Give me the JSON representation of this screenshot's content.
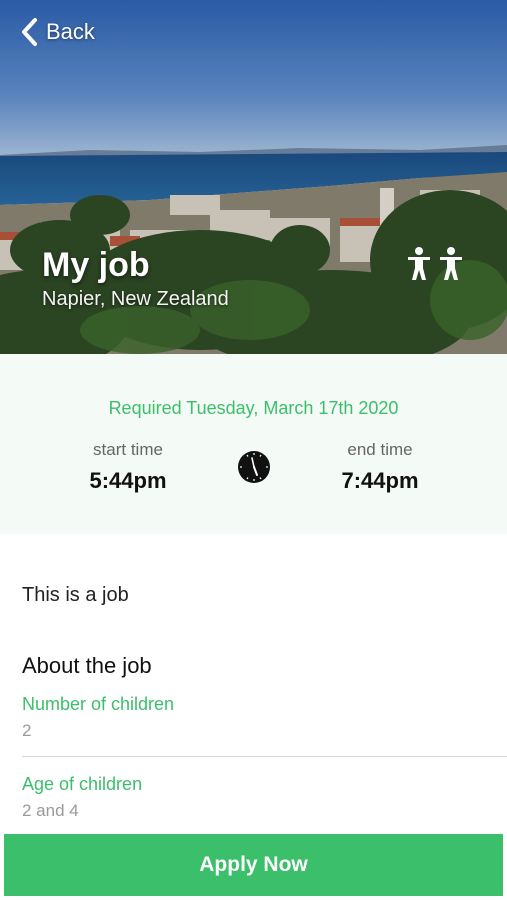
{
  "header": {
    "back_label": "Back",
    "title": "My job",
    "location": "Napier, New Zealand"
  },
  "schedule": {
    "required": "Required Tuesday, March 17th 2020",
    "start_label": "start time",
    "start_value": "5:44pm",
    "end_label": "end time",
    "end_value": "7:44pm"
  },
  "job": {
    "description": "This is a job",
    "about_heading": "About the job",
    "fields": [
      {
        "label": "Number of children",
        "value": "2"
      },
      {
        "label": "Age of children",
        "value": "2 and 4"
      }
    ]
  },
  "actions": {
    "apply_label": "Apply Now"
  },
  "colors": {
    "accent": "#3cbf6b",
    "panel_bg": "#f4faf6"
  },
  "icons": {
    "back": "chevron-left-icon",
    "children": "children-icon",
    "clock": "clock-icon"
  }
}
